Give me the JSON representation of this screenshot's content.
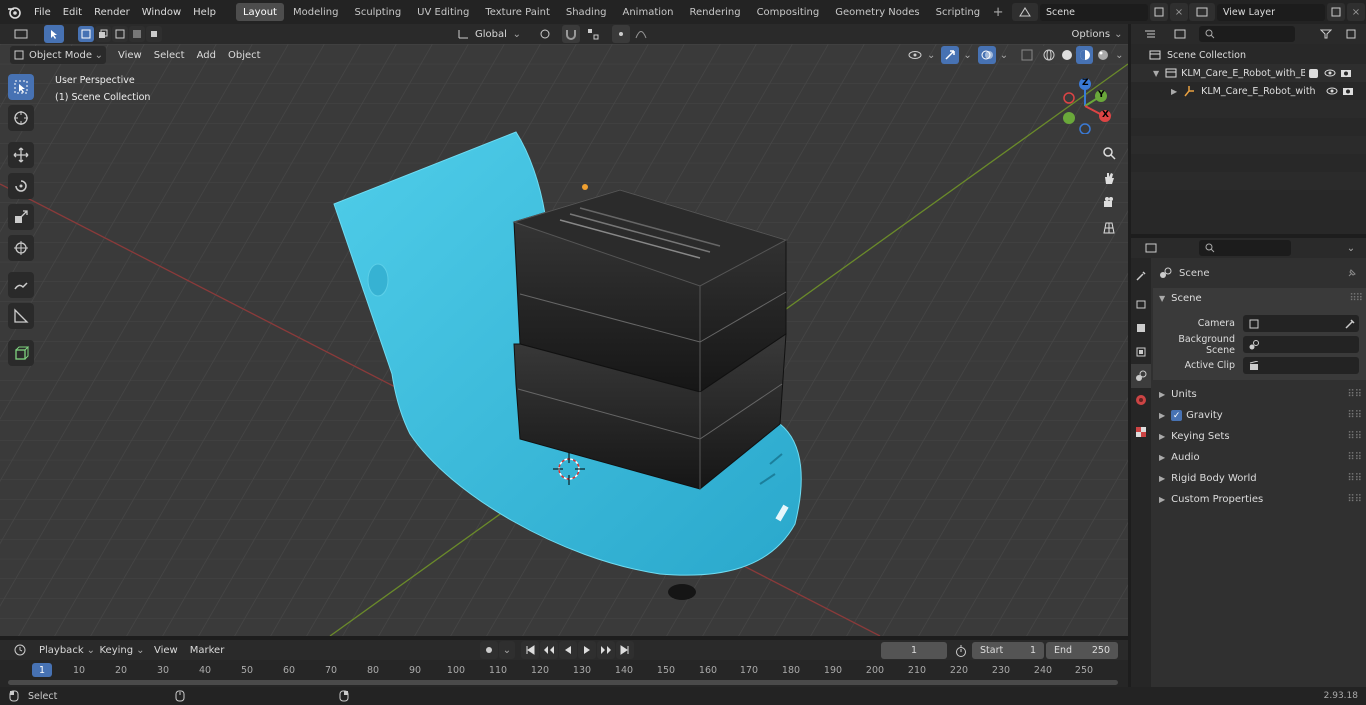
{
  "topbar": {
    "menus": [
      "File",
      "Edit",
      "Render",
      "Window",
      "Help"
    ],
    "workspaces": [
      "Layout",
      "Modeling",
      "Sculpting",
      "UV Editing",
      "Texture Paint",
      "Shading",
      "Animation",
      "Rendering",
      "Compositing",
      "Geometry Nodes",
      "Scripting"
    ],
    "active_workspace": "Layout",
    "scene": "Scene",
    "view_layer": "View Layer"
  },
  "header": {
    "orientation": "Global",
    "options": "Options"
  },
  "viewport_header": {
    "mode": "Object Mode",
    "menus": [
      "View",
      "Select",
      "Add",
      "Object"
    ]
  },
  "viewport": {
    "perspective": "User Perspective",
    "collection": "(1) Scene Collection",
    "gizmo": {
      "z": "Z",
      "y": "Y",
      "x": "X"
    }
  },
  "outliner": {
    "root": "Scene Collection",
    "collection": "KLM_Care_E_Robot_with_Bla",
    "object": "KLM_Care_E_Robot_with"
  },
  "properties": {
    "context": "Scene",
    "panel": "Scene",
    "fields": [
      {
        "label": "Camera"
      },
      {
        "label": "Background Scene"
      },
      {
        "label": "Active Clip"
      }
    ],
    "sections": [
      "Units",
      "Gravity",
      "Keying Sets",
      "Audio",
      "Rigid Body World",
      "Custom Properties"
    ]
  },
  "timeline": {
    "menus": [
      "Playback",
      "Keying",
      "View",
      "Marker"
    ],
    "current_frame": "1",
    "start_label": "Start",
    "start": "1",
    "end_label": "End",
    "end": "250",
    "ticks": [
      "1",
      "10",
      "20",
      "30",
      "40",
      "50",
      "60",
      "70",
      "80",
      "90",
      "100",
      "110",
      "120",
      "130",
      "140",
      "150",
      "160",
      "170",
      "180",
      "190",
      "200",
      "210",
      "220",
      "230",
      "240",
      "250"
    ]
  },
  "status": {
    "left": "Select",
    "version": "2.93.18"
  },
  "colors": {
    "accent": "#4772b3",
    "robot": "#3fbfdc",
    "header": "#232323"
  }
}
